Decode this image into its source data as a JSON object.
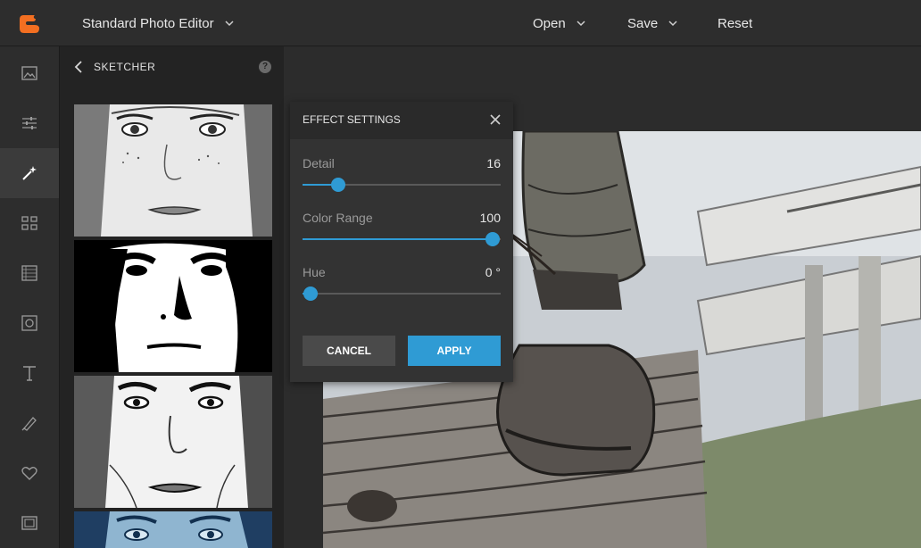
{
  "app": {
    "title": "Standard Photo Editor",
    "brand_color": "#f36f21"
  },
  "header": {
    "open_label": "Open",
    "save_label": "Save",
    "reset_label": "Reset"
  },
  "leftrail": {
    "items": [
      {
        "icon": "image-icon",
        "active": false
      },
      {
        "icon": "sliders-icon",
        "active": false
      },
      {
        "icon": "magic-wand-icon",
        "active": true
      },
      {
        "icon": "grid-icon",
        "active": false
      },
      {
        "icon": "texture-icon",
        "active": false
      },
      {
        "icon": "frame-icon",
        "active": false
      },
      {
        "icon": "text-icon",
        "active": false
      },
      {
        "icon": "brush-icon",
        "active": false
      },
      {
        "icon": "heart-icon",
        "active": false
      },
      {
        "icon": "border-icon",
        "active": false
      }
    ]
  },
  "panel": {
    "title": "SKETCHER",
    "help": "?"
  },
  "dialog": {
    "title": "EFFECT SETTINGS",
    "sliders": [
      {
        "label": "Detail",
        "value": "16",
        "fraction": 0.18
      },
      {
        "label": "Color Range",
        "value": "100",
        "fraction": 0.96
      },
      {
        "label": "Hue",
        "value": "0 °",
        "fraction": 0.04
      }
    ],
    "cancel_label": "CANCEL",
    "apply_label": "APPLY"
  },
  "colors": {
    "accent": "#2f9bd4"
  }
}
